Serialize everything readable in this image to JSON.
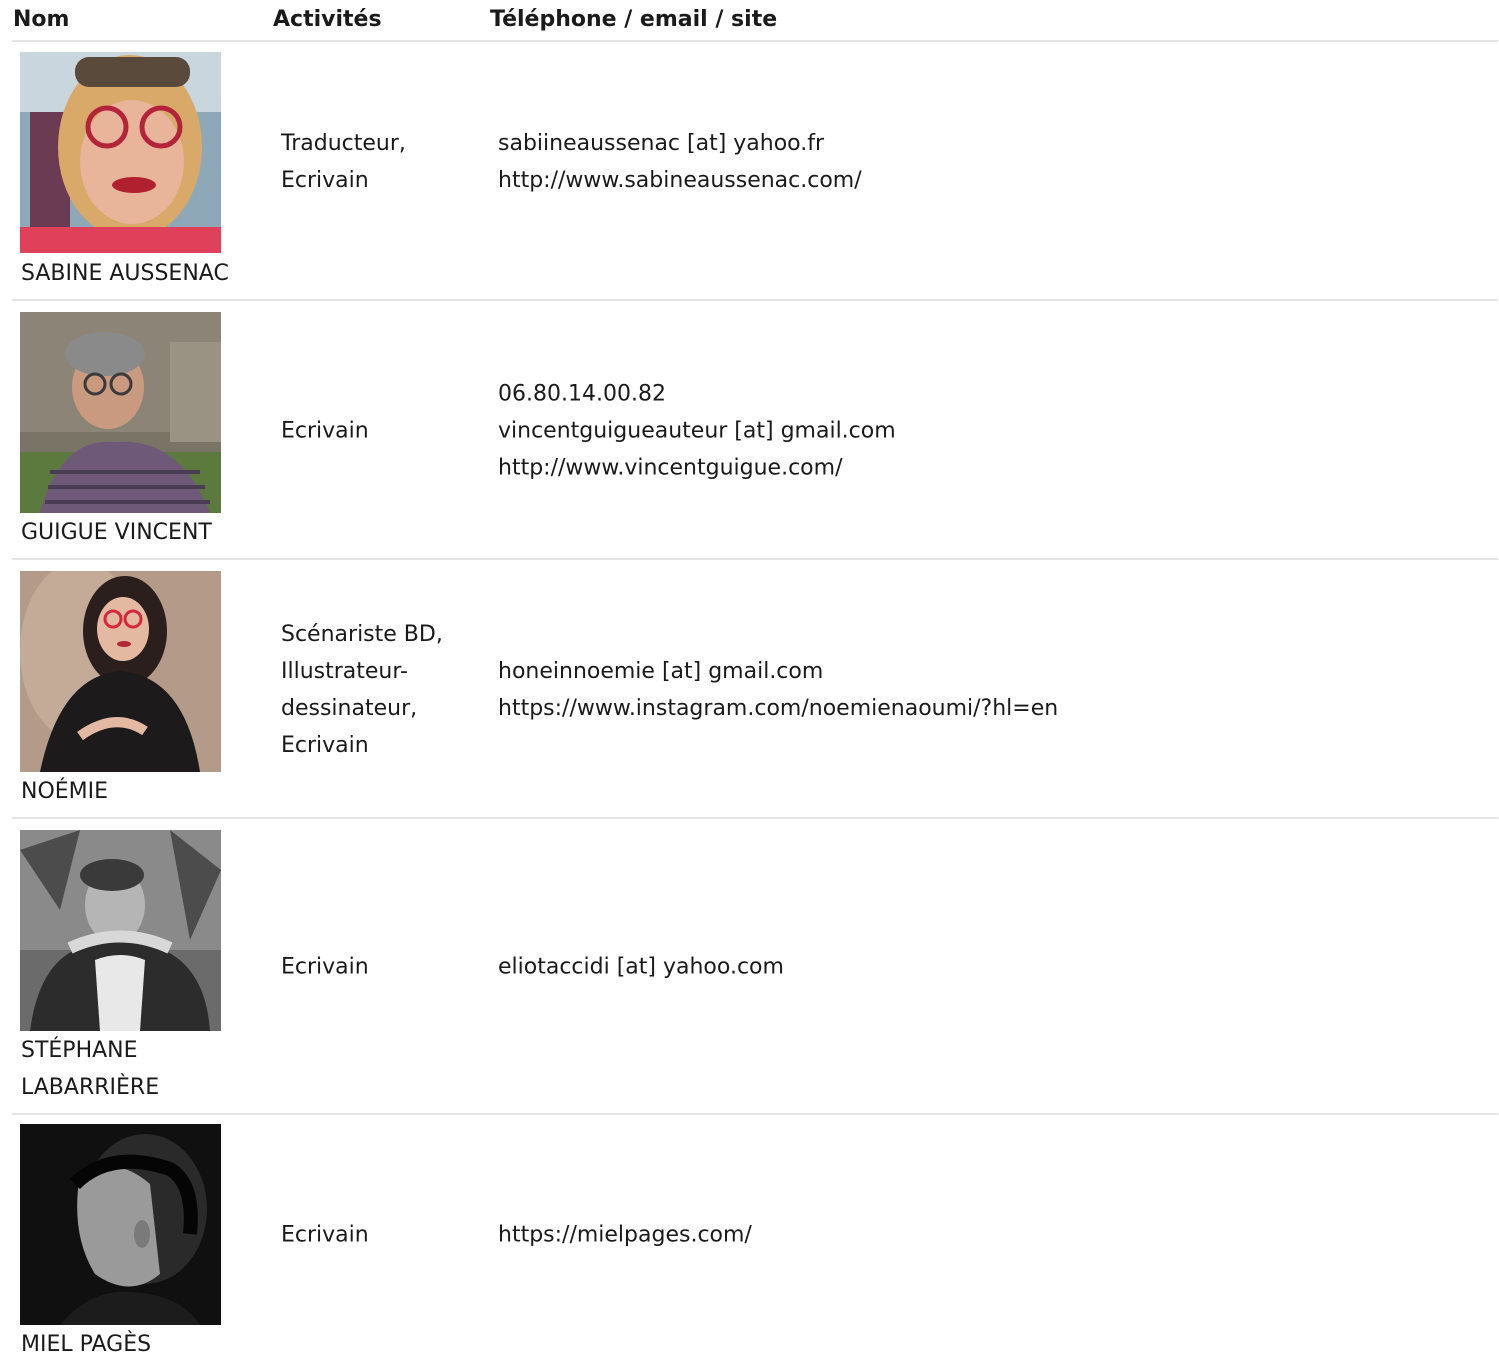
{
  "table": {
    "headers": {
      "name": "Nom",
      "activities": "Activités",
      "contact": "Téléphone / email / site"
    },
    "rows": [
      {
        "photo_alt": "portrait",
        "name_lines": [
          "SABINE AUSSENAC"
        ],
        "activity_lines": [
          "Traducteur,",
          "Ecrivain"
        ],
        "contact_lines": [
          "sabiineaussenac [at] yahoo.fr",
          "http://www.sabineaussenac.com/"
        ]
      },
      {
        "photo_alt": "portrait",
        "name_lines": [
          "GUIGUE VINCENT"
        ],
        "activity_lines": [
          "Ecrivain"
        ],
        "contact_lines": [
          "06.80.14.00.82",
          "vincentguigueauteur [at] gmail.com",
          "http://www.vincentguigue.com/"
        ]
      },
      {
        "photo_alt": "portrait",
        "name_lines": [
          "NOÉMIE"
        ],
        "activity_lines": [
          "Scénariste BD,",
          "Illustrateur-",
          "dessinateur,",
          "Ecrivain"
        ],
        "contact_lines": [
          "honeinnoemie [at] gmail.com",
          "https://www.instagram.com/noemienaoumi/?hl=en"
        ]
      },
      {
        "photo_alt": "portrait",
        "name_lines": [
          "STÉPHANE",
          "LABARRIÈRE"
        ],
        "activity_lines": [
          "Ecrivain"
        ],
        "contact_lines": [
          "eliotaccidi [at] yahoo.com"
        ]
      },
      {
        "photo_alt": "portrait",
        "name_lines": [
          "MIEL PAGÈS"
        ],
        "activity_lines": [
          "Ecrivain"
        ],
        "contact_lines": [
          "https://mielpages.com/"
        ]
      }
    ]
  },
  "colors": {
    "divider": "#e3e3e3",
    "text": "#1a1a1a",
    "link_text": "#1a1a1a"
  }
}
